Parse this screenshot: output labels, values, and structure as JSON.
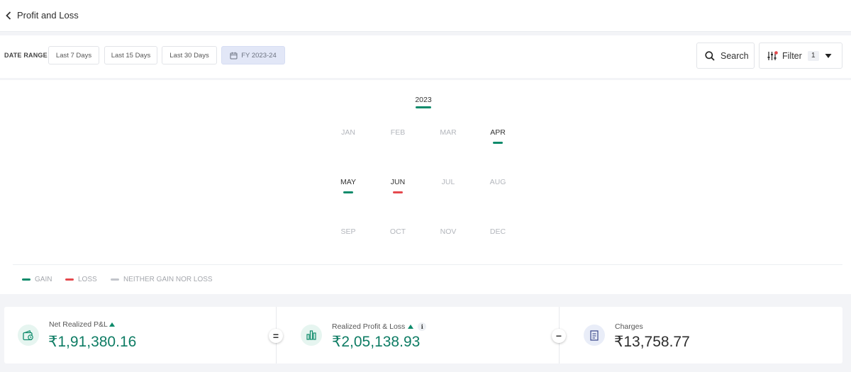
{
  "header": {
    "title": "Profit and Loss"
  },
  "toolbar": {
    "range_label": "DATE RANGE",
    "ranges": [
      {
        "label": "Last 7 Days",
        "active": false
      },
      {
        "label": "Last 15 Days",
        "active": false
      },
      {
        "label": "Last 30 Days",
        "active": false
      },
      {
        "label": "FY 2023-24",
        "active": true
      }
    ],
    "search_label": "Search",
    "filter_label": "Filter",
    "filter_count": "1"
  },
  "calendar": {
    "year": "2023",
    "year_status": "gain",
    "months": [
      {
        "label": "JAN",
        "status": "none",
        "active": false
      },
      {
        "label": "FEB",
        "status": "none",
        "active": false
      },
      {
        "label": "MAR",
        "status": "none",
        "active": false
      },
      {
        "label": "APR",
        "status": "gain",
        "active": true
      },
      {
        "label": "MAY",
        "status": "gain",
        "active": true
      },
      {
        "label": "JUN",
        "status": "loss",
        "active": true
      },
      {
        "label": "JUL",
        "status": "none",
        "active": false
      },
      {
        "label": "AUG",
        "status": "none",
        "active": false
      },
      {
        "label": "SEP",
        "status": "none",
        "active": false
      },
      {
        "label": "OCT",
        "status": "none",
        "active": false
      },
      {
        "label": "NOV",
        "status": "none",
        "active": false
      },
      {
        "label": "DEC",
        "status": "none",
        "active": false
      }
    ]
  },
  "legend": [
    {
      "label": "GAIN",
      "color": "#0e8b6b"
    },
    {
      "label": "LOSS",
      "color": "#e5484d"
    },
    {
      "label": "NEITHER GAIN NOR LOSS",
      "color": "#c2c5cb"
    }
  ],
  "summary": {
    "net": {
      "label": "Net Realized P&L",
      "value": "₹1,91,380.16"
    },
    "equals": "=",
    "realized": {
      "label": "Realized Profit & Loss",
      "value": "₹2,05,138.93",
      "info": "i"
    },
    "minus": "−",
    "charges": {
      "label": "Charges",
      "value": "₹13,758.77"
    }
  },
  "colors": {
    "gain": "#0e8b6b",
    "loss": "#e5484d",
    "neutral": "#c2c5cb",
    "accent_bg": "#e2e7f7"
  }
}
